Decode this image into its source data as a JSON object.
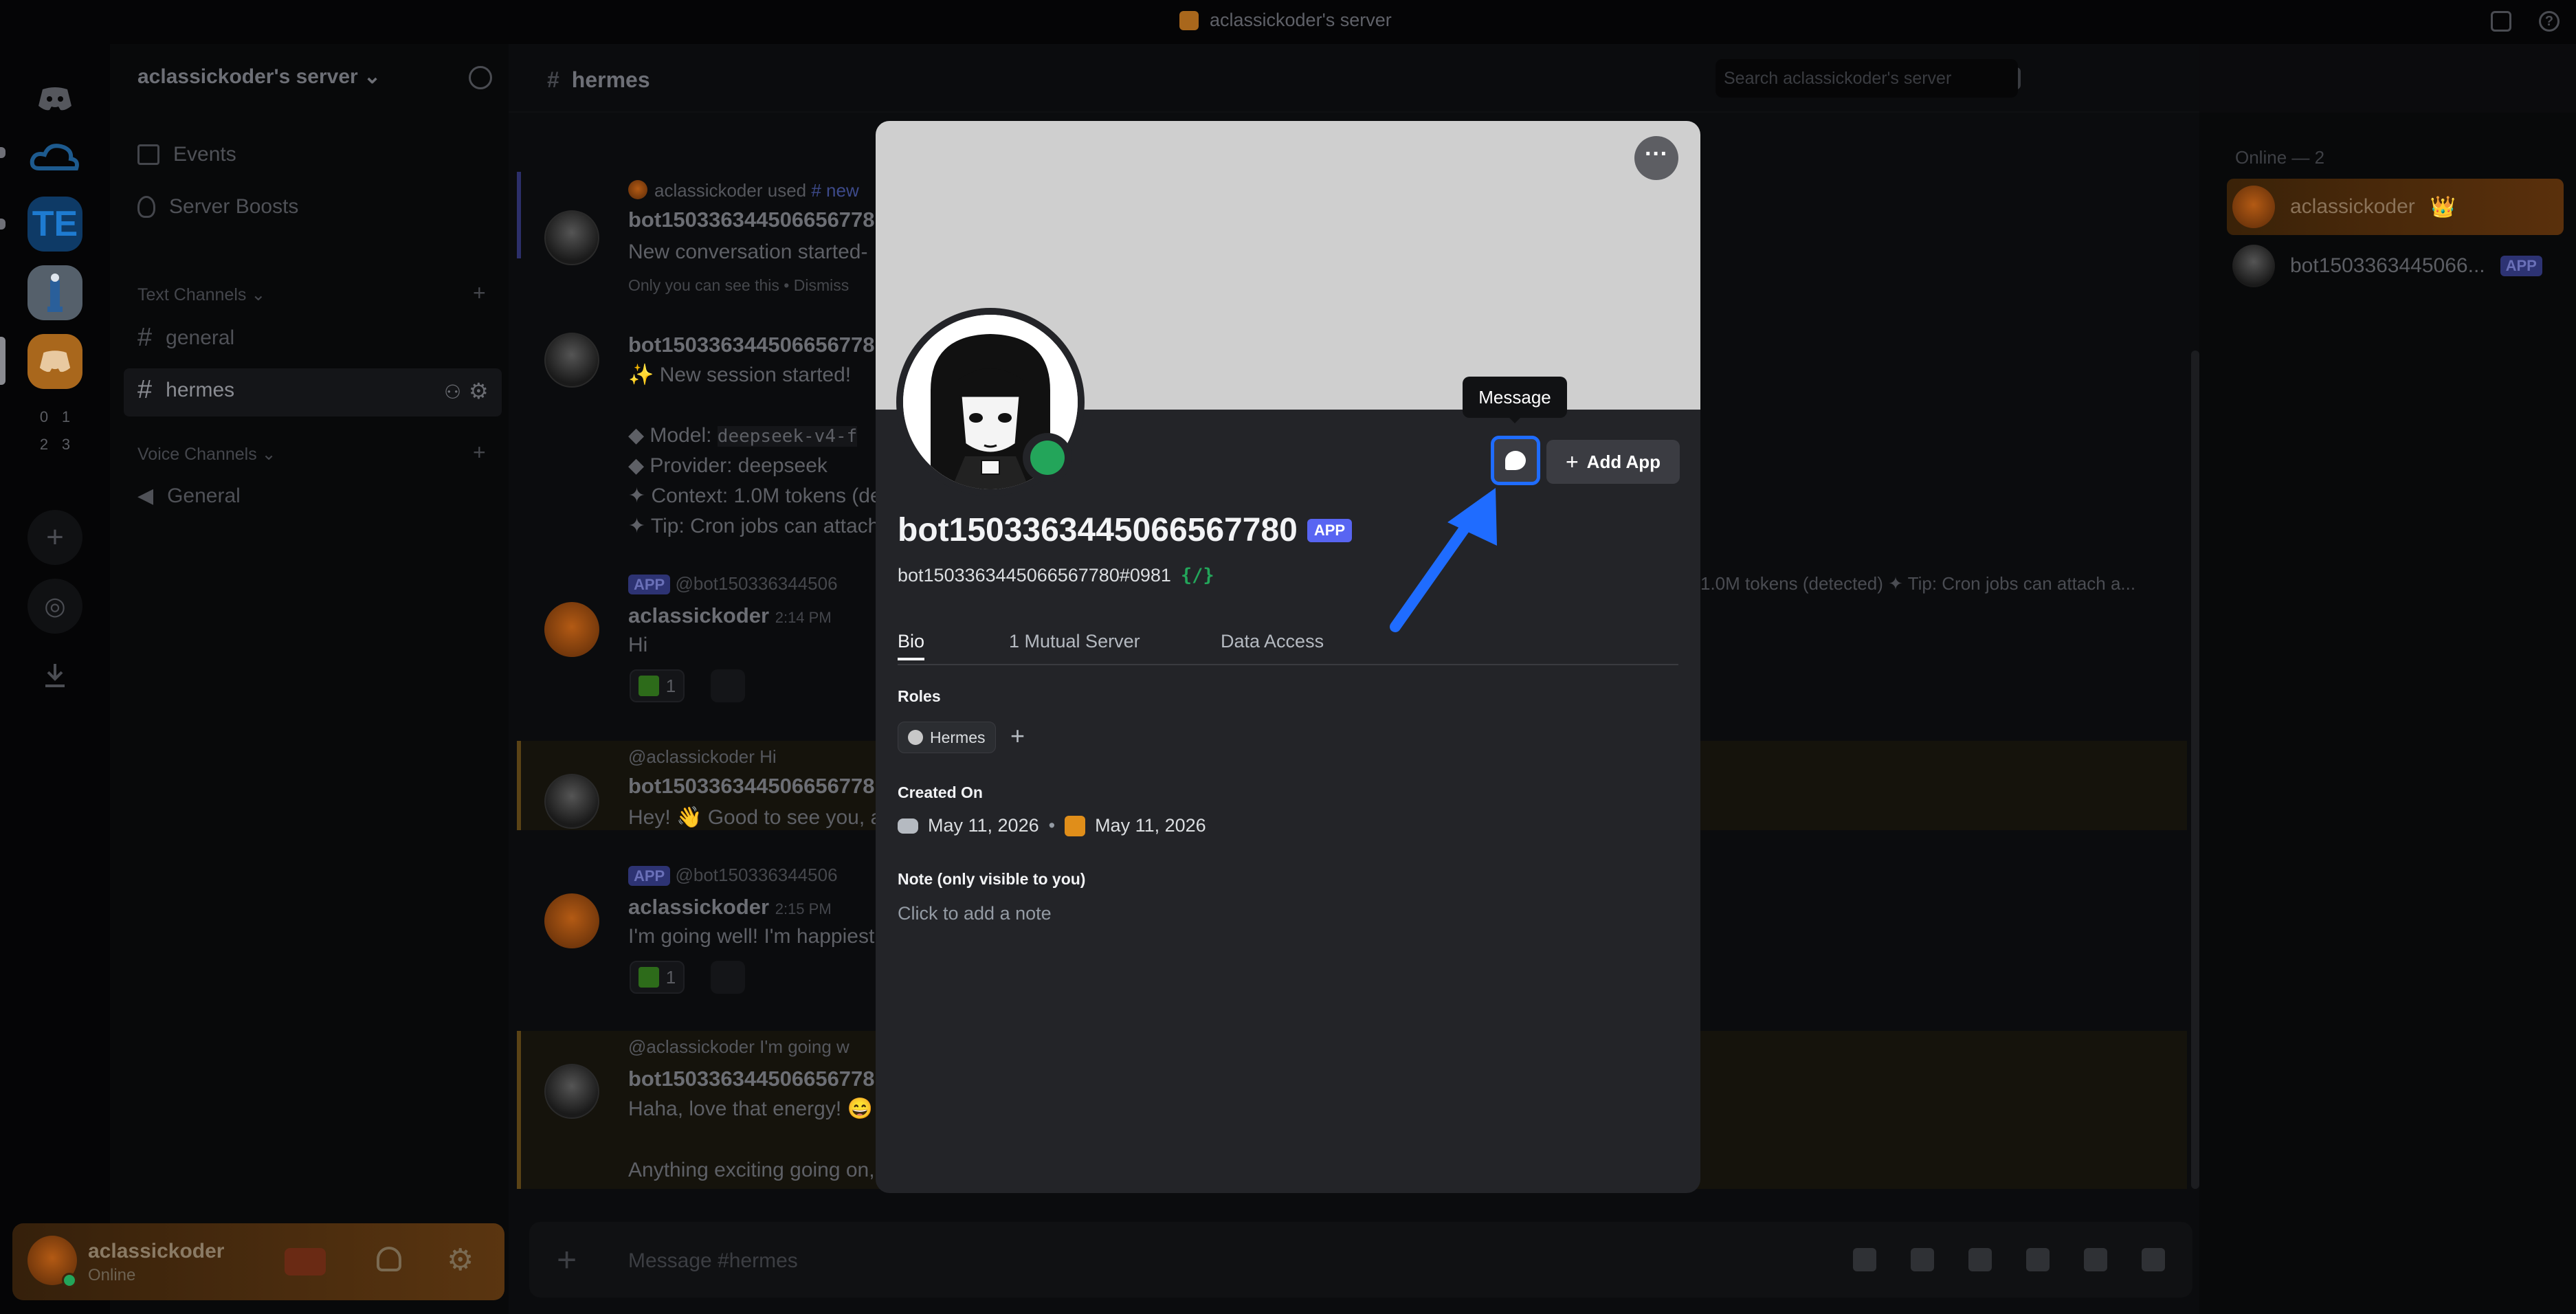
{
  "window": {
    "title": "aclassickoder's server"
  },
  "server": {
    "name": "aclassickoder's server"
  },
  "rail": {
    "folder_numbers": [
      "0",
      "1",
      "2",
      "3"
    ]
  },
  "sidebar": {
    "items": [
      {
        "label": "Events"
      },
      {
        "label": "Server Boosts"
      }
    ],
    "text_channels_label": "Text Channels",
    "text_channels": [
      {
        "label": "general"
      },
      {
        "label": "hermes"
      }
    ],
    "voice_channels_label": "Voice Channels",
    "voice_channels": [
      {
        "label": "General"
      }
    ]
  },
  "user": {
    "name": "aclassickoder",
    "status": "Online"
  },
  "chat": {
    "channel": "hermes",
    "search_placeholder": "Search aclassickoder's server",
    "composer_placeholder": "Message #hermes",
    "messages": [
      {
        "reply_user": "aclassickoder",
        "reply_used": "used",
        "reply_cmd": "# new",
        "author": "bot150336344506656778",
        "text": "New conversation started-",
        "ephemeral": "Only you can see this • Dismiss"
      },
      {
        "author": "bot150336344506656778",
        "line1": "✨ New session started!",
        "line2": "◆ Model: ",
        "line2_code": "deepseek-v4-f",
        "line3": "◆ Provider: deepseek",
        "line4": "✦ Context: 1.0M tokens (de",
        "line5": "✦ Tip: Cron jobs can attach"
      },
      {
        "reply_badge": "APP",
        "reply_text": "@bot150336344506",
        "reply_tail": "1.0M tokens (detected) ✦ Tip: Cron jobs can attach a...",
        "author": "aclassickoder",
        "time": "2:14 PM",
        "text": "Hi",
        "reaction_count": "1"
      },
      {
        "reply_text": "@aclassickoder Hi",
        "author": "bot150336344506656778",
        "text": "Hey! 👋 Good to see you, a"
      },
      {
        "reply_badge": "APP",
        "reply_text": "@bot150336344506",
        "author": "aclassickoder",
        "time": "2:15 PM",
        "text": "I'm going well! I'm happiest",
        "reaction_count": "1"
      },
      {
        "reply_text": "@aclassickoder I'm going w",
        "author": "bot150336344506656778",
        "text": "Haha, love that energy! 😄",
        "text2": "Anything exciting going on,"
      }
    ]
  },
  "members": {
    "header": "Online — 2",
    "list": [
      {
        "name": "aclassickoder",
        "badge": "👑"
      },
      {
        "name": "bot15033634450​66...",
        "badge": "APP"
      }
    ]
  },
  "profile": {
    "username": "bot1503363445066567780",
    "badge": "APP",
    "tag": "bot1503363445066567780#0981",
    "slash_icon": "{/}",
    "tooltip": "Message",
    "add_app": "Add App",
    "tabs": [
      "Bio",
      "1 Mutual Server",
      "Data Access"
    ],
    "roles_label": "Roles",
    "role": "Hermes",
    "created_label": "Created On",
    "created_discord": "May 11, 2026",
    "created_server": "May 11, 2026",
    "note_label": "Note (only visible to you)",
    "note_placeholder": "Click to add a note"
  },
  "colors": {
    "accent": "#1f6cff",
    "online": "#23a55a",
    "app_badge": "#5865f2"
  }
}
